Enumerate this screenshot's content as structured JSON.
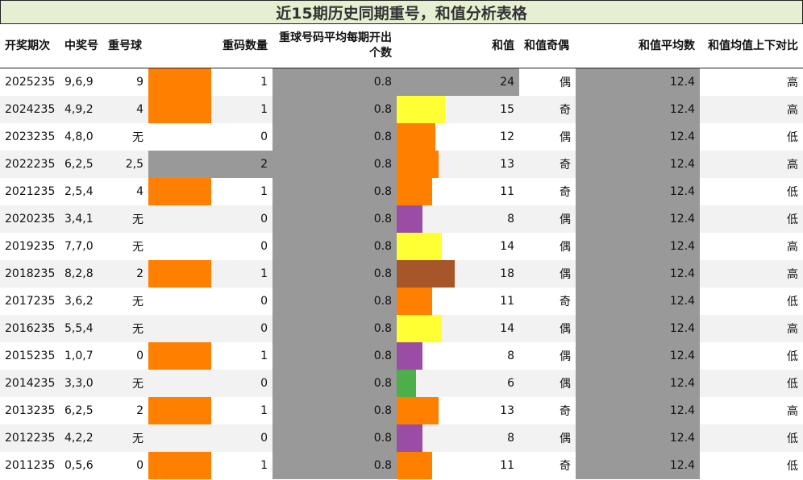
{
  "title": "近15期历史同期重号，和值分析表格",
  "headers": [
    "开奖期次",
    "中奖号",
    "重号球",
    "",
    "重码数量",
    "重球号码平均每期开出个数",
    "",
    "和值",
    "和值奇偶",
    "和值平均数",
    "和值均值上下对比"
  ],
  "colors": {
    "orange": "#ff8000",
    "yellow": "#ffff33",
    "purple": "#9b4ca4",
    "green": "#4daf4a",
    "brown": "#a65628",
    "grey": "#999999",
    "title_bg": "#e5f0d3"
  },
  "chart_data": {
    "type": "table",
    "columns": [
      "开奖期次",
      "中奖号",
      "重号球",
      "重码数量",
      "重球号码平均每期开出个数",
      "和值",
      "和值奇偶",
      "和值平均数",
      "和值均值上下对比"
    ],
    "sum_bar_max": 24,
    "rows": [
      {
        "period": "2025235",
        "numbers": "9,6,9",
        "repeat_ball": "9",
        "repeat_count": 1,
        "repeat_avg": "0.8",
        "sum": 24,
        "parity": "偶",
        "sum_avg": "12.4",
        "compare": "高",
        "sum_color": "grey"
      },
      {
        "period": "2024235",
        "numbers": "4,9,2",
        "repeat_ball": "4",
        "repeat_count": 1,
        "repeat_avg": "0.8",
        "sum": 15,
        "parity": "奇",
        "sum_avg": "12.4",
        "compare": "高",
        "sum_color": "yellow"
      },
      {
        "period": "2023235",
        "numbers": "4,8,0",
        "repeat_ball": "无",
        "repeat_count": 0,
        "repeat_avg": "0.8",
        "sum": 12,
        "parity": "偶",
        "sum_avg": "12.4",
        "compare": "低",
        "sum_color": "orange"
      },
      {
        "period": "2022235",
        "numbers": "6,2,5",
        "repeat_ball": "2,5",
        "repeat_count": 2,
        "repeat_avg": "0.8",
        "sum": 13,
        "parity": "奇",
        "sum_avg": "12.4",
        "compare": "高",
        "sum_color": "orange"
      },
      {
        "period": "2021235",
        "numbers": "2,5,4",
        "repeat_ball": "4",
        "repeat_count": 1,
        "repeat_avg": "0.8",
        "sum": 11,
        "parity": "奇",
        "sum_avg": "12.4",
        "compare": "低",
        "sum_color": "orange"
      },
      {
        "period": "2020235",
        "numbers": "3,4,1",
        "repeat_ball": "无",
        "repeat_count": 0,
        "repeat_avg": "0.8",
        "sum": 8,
        "parity": "偶",
        "sum_avg": "12.4",
        "compare": "低",
        "sum_color": "purple"
      },
      {
        "period": "2019235",
        "numbers": "7,7,0",
        "repeat_ball": "无",
        "repeat_count": 0,
        "repeat_avg": "0.8",
        "sum": 14,
        "parity": "偶",
        "sum_avg": "12.4",
        "compare": "高",
        "sum_color": "yellow"
      },
      {
        "period": "2018235",
        "numbers": "8,2,8",
        "repeat_ball": "2",
        "repeat_count": 1,
        "repeat_avg": "0.8",
        "sum": 18,
        "parity": "偶",
        "sum_avg": "12.4",
        "compare": "高",
        "sum_color": "brown"
      },
      {
        "period": "2017235",
        "numbers": "3,6,2",
        "repeat_ball": "无",
        "repeat_count": 0,
        "repeat_avg": "0.8",
        "sum": 11,
        "parity": "奇",
        "sum_avg": "12.4",
        "compare": "低",
        "sum_color": "orange"
      },
      {
        "period": "2016235",
        "numbers": "5,5,4",
        "repeat_ball": "无",
        "repeat_count": 0,
        "repeat_avg": "0.8",
        "sum": 14,
        "parity": "偶",
        "sum_avg": "12.4",
        "compare": "高",
        "sum_color": "yellow"
      },
      {
        "period": "2015235",
        "numbers": "1,0,7",
        "repeat_ball": "0",
        "repeat_count": 1,
        "repeat_avg": "0.8",
        "sum": 8,
        "parity": "偶",
        "sum_avg": "12.4",
        "compare": "低",
        "sum_color": "purple"
      },
      {
        "period": "2014235",
        "numbers": "3,3,0",
        "repeat_ball": "无",
        "repeat_count": 0,
        "repeat_avg": "0.8",
        "sum": 6,
        "parity": "偶",
        "sum_avg": "12.4",
        "compare": "低",
        "sum_color": "green"
      },
      {
        "period": "2013235",
        "numbers": "6,2,5",
        "repeat_ball": "2",
        "repeat_count": 1,
        "repeat_avg": "0.8",
        "sum": 13,
        "parity": "奇",
        "sum_avg": "12.4",
        "compare": "高",
        "sum_color": "orange"
      },
      {
        "period": "2012235",
        "numbers": "4,2,2",
        "repeat_ball": "无",
        "repeat_count": 0,
        "repeat_avg": "0.8",
        "sum": 8,
        "parity": "偶",
        "sum_avg": "12.4",
        "compare": "低",
        "sum_color": "purple"
      },
      {
        "period": "2011235",
        "numbers": "0,5,6",
        "repeat_ball": "0",
        "repeat_count": 1,
        "repeat_avg": "0.8",
        "sum": 11,
        "parity": "奇",
        "sum_avg": "12.4",
        "compare": "低",
        "sum_color": "orange"
      }
    ]
  }
}
